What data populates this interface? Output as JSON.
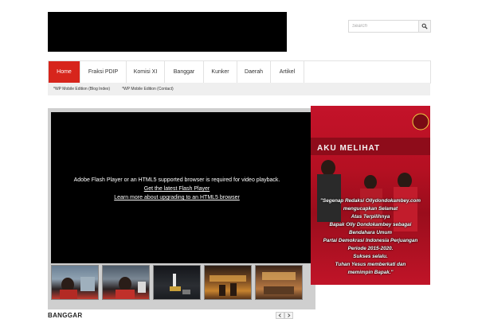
{
  "header": {
    "search_placeholder": "Search"
  },
  "nav": {
    "items": [
      {
        "label": "Home",
        "active": true
      },
      {
        "label": "Fraksi PDIP",
        "active": false
      },
      {
        "label": "Komisi XI",
        "active": false
      },
      {
        "label": "Banggar",
        "active": false
      },
      {
        "label": "Kunker",
        "active": false
      },
      {
        "label": "Daerah",
        "active": false
      },
      {
        "label": "Artikel",
        "active": false
      }
    ]
  },
  "subnav": {
    "items": [
      {
        "label": "*WP Mobile Edition (Blog Index)"
      },
      {
        "label": "*WP Mobile Edition (Contact)"
      }
    ]
  },
  "player": {
    "message": "Adobe Flash Player or an HTML5 supported browser is required for video playback.",
    "link_flash": "Get the latest Flash Player",
    "link_html5": "Learn more about upgrading to an HTML5 browser"
  },
  "promo": {
    "banner_text": "AKU MELIHAT",
    "caption_lines": [
      "\"Segenap Redaksi Ollydondokambey.com",
      "mengucapkan Selamat",
      "Atas Terpilihnya",
      "Bapak Olly Dondokambey sebagai",
      "Bendahara Umum",
      "Partai Demokrasi Indonesia Perjuangan",
      "Periode 2015-2020.",
      "Sukses selalu.",
      "Tuhan Yesus memberkati dan",
      "memimpin Bapak.\""
    ]
  },
  "section": {
    "title": "BANGGAR"
  },
  "colors": {
    "accent_red": "#d7251c",
    "nav_border": "#e2e2e2",
    "subnav_bg": "#efefef"
  },
  "icons": {
    "search": "magnifier-icon",
    "prev": "chevron-left-icon",
    "next": "chevron-right-icon"
  }
}
